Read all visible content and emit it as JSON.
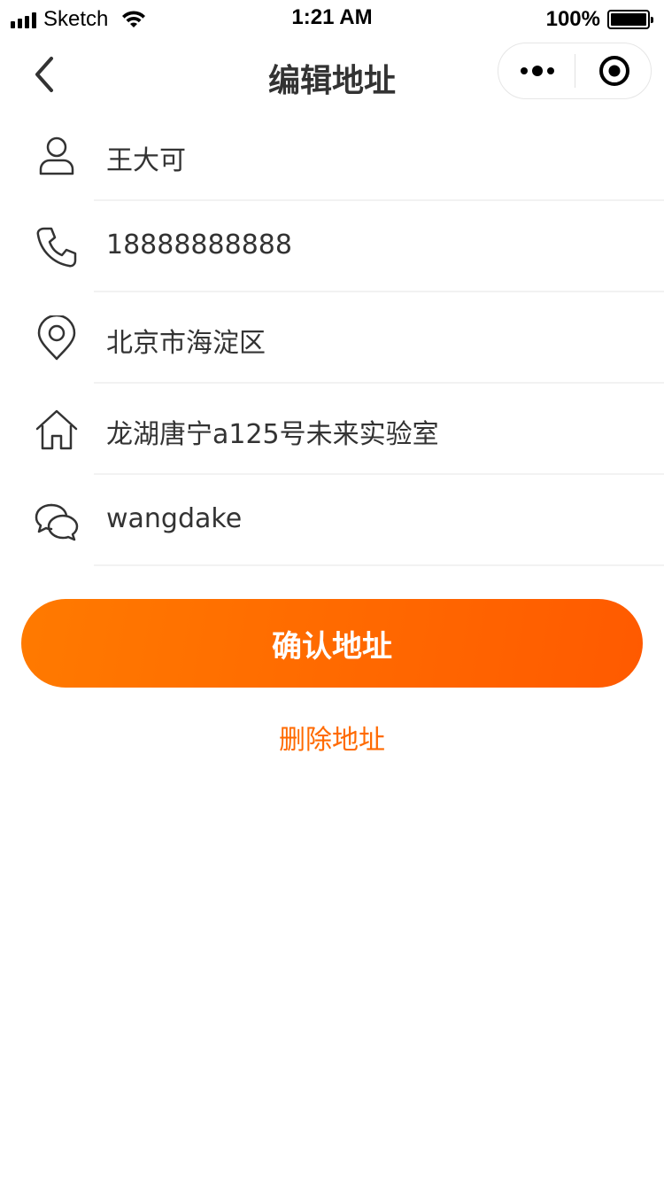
{
  "status_bar": {
    "carrier": "Sketch",
    "time": "1:21 AM",
    "battery": "100%"
  },
  "nav": {
    "title": "编辑地址",
    "capsule_icons": [
      "more-dots-icon",
      "record-icon"
    ]
  },
  "form": {
    "rows": [
      {
        "icon": "person-icon",
        "value": "王大可"
      },
      {
        "icon": "phone-icon",
        "value": "18888888888"
      },
      {
        "icon": "location-pin-icon",
        "value": "北京市海淀区"
      },
      {
        "icon": "house-icon",
        "value": "龙湖唐宁a125号未来实验室"
      },
      {
        "icon": "chat-bubbles-icon",
        "value": "wangdake"
      }
    ]
  },
  "actions": {
    "confirm_label": "确认地址",
    "delete_label": "删除地址"
  },
  "colors": {
    "accent": "#ff6a00",
    "gradient_start": "#ff7a00",
    "gradient_end": "#ff5a00",
    "text": "#333333",
    "divider": "#f2f2f2"
  }
}
